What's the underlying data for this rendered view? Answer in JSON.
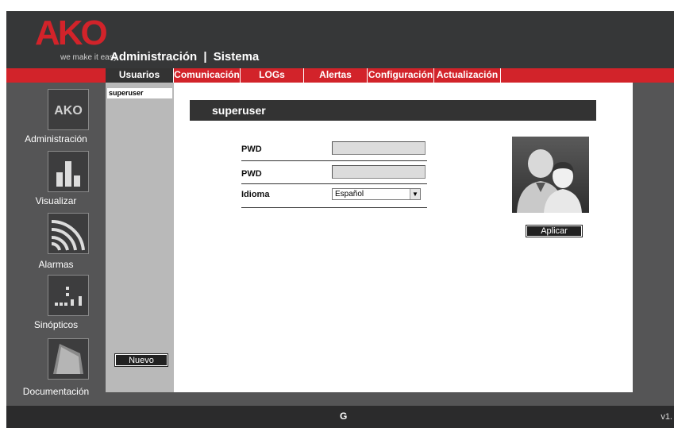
{
  "brand": {
    "logo_text": "AKO",
    "tagline": "we make it easy",
    "color": "#d2232a"
  },
  "header": {
    "title_main": "Administración",
    "separator": "|",
    "title_sub": "Sistema"
  },
  "tabs": [
    {
      "label": "Usuarios",
      "active": true
    },
    {
      "label": "Comunicación",
      "active": false
    },
    {
      "label": "LOGs",
      "active": false
    },
    {
      "label": "Alertas",
      "active": false
    },
    {
      "label": "Configuración",
      "active": false
    },
    {
      "label": "Actualización",
      "active": false
    }
  ],
  "nav": [
    {
      "label": "Administración",
      "icon": "ako-logo-icon"
    },
    {
      "label": "Visualizar",
      "icon": "bar-chart-icon"
    },
    {
      "label": "Alarmas",
      "icon": "signal-arcs-icon"
    },
    {
      "label": "Sinópticos",
      "icon": "dot-grid-icon"
    },
    {
      "label": "Documentación",
      "icon": "book-icon"
    }
  ],
  "users": {
    "items": [
      "superuser"
    ],
    "new_button": "Nuevo"
  },
  "form": {
    "title": "superuser",
    "pwd_label": "PWD",
    "pwd_confirm_label": "PWD",
    "language_label": "Idioma",
    "language_value": "Español",
    "apply_button": "Aplicar"
  },
  "footer": {
    "refresh_symbol": "G",
    "version": "v1."
  }
}
